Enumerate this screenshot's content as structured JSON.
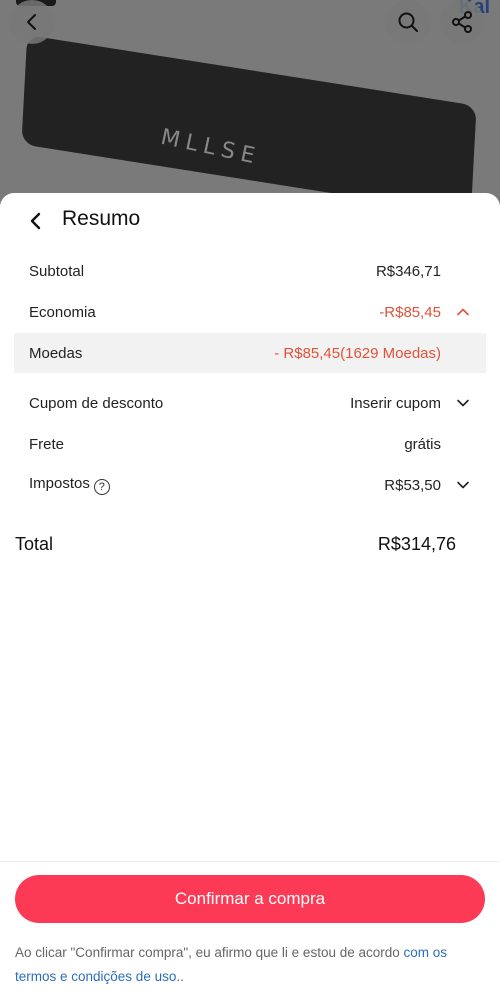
{
  "background": {
    "device_brand": "MLLSE",
    "corner_logo": "Kal"
  },
  "top_icons": {
    "back": "chevron-left-icon",
    "search": "search-icon",
    "share": "share-icon"
  },
  "sheet": {
    "title": "Resumo",
    "rows": {
      "subtotal": {
        "label": "Subtotal",
        "value": "R$346,71"
      },
      "economia": {
        "label": "Economia",
        "value": "-R$85,45"
      },
      "moedas": {
        "label": "Moedas",
        "value": "- R$85,45(1629 Moedas)"
      },
      "cupom": {
        "label": "Cupom de desconto",
        "value": "Inserir cupom"
      },
      "frete": {
        "label": "Frete",
        "value": "grátis"
      },
      "impostos": {
        "label": "Impostos",
        "help": "?",
        "value": "R$53,50"
      }
    },
    "total": {
      "label": "Total",
      "value": "R$314,76"
    }
  },
  "footer": {
    "confirm_label": "Confirmar a compra",
    "terms_text": "Ao clicar \"Confirmar compra\", eu afirmo que li e estou de acordo ",
    "terms_link": "com os termos e condições de uso",
    "terms_end": ".."
  },
  "colors": {
    "accent": "#fd3a56",
    "discount": "#e0523a",
    "link": "#2a6ebb"
  }
}
